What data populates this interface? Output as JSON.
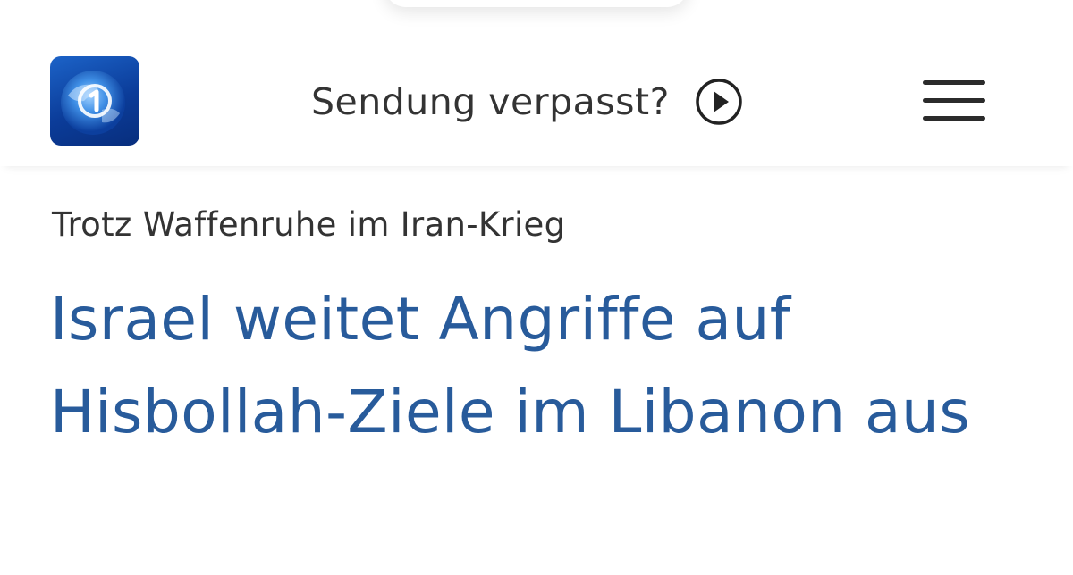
{
  "header": {
    "logo_icon": "tagesschau-globe-logo-icon",
    "missed_show_label": "Sendung verpasst?",
    "play_icon": "play-circle-icon",
    "menu_icon": "hamburger-menu-icon"
  },
  "article": {
    "kicker": "Trotz Waffenruhe im Iran-Krieg",
    "headline": "Israel weitet Angriffe auf Hisbollah-Ziele im Libanon aus"
  },
  "colors": {
    "headline": "#285b9b",
    "text": "#333333",
    "logo_blue": "#0b3c99"
  }
}
